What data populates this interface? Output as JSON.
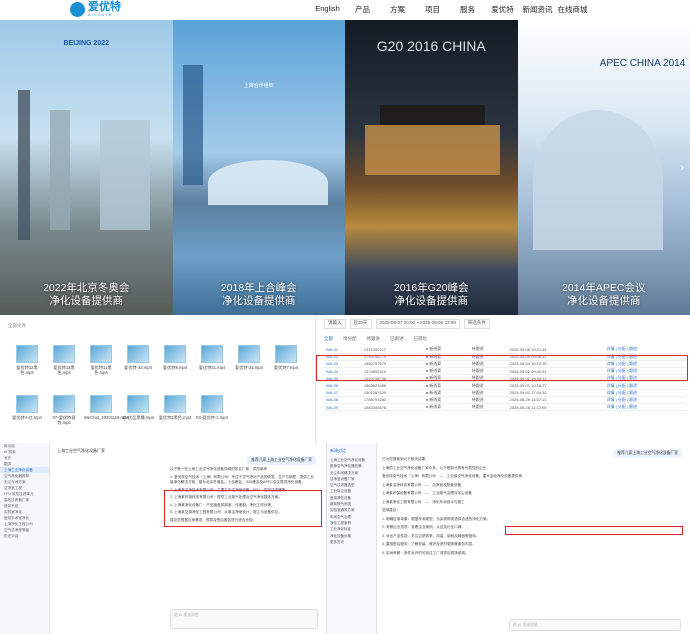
{
  "brand": {
    "name": "爱优特",
    "tagline": "AIYOUTE"
  },
  "nav": [
    "English",
    "产品",
    "方案",
    "项目",
    "服务",
    "爱优特",
    "新闻资讯",
    "在线商城"
  ],
  "banner": {
    "panels": [
      {
        "tag": "BEIJING 2022",
        "caption1": "2022年北京冬奥会",
        "caption2": "净化设备提供商"
      },
      {
        "tag": "上海合作组织",
        "caption1": "2018年上合峰会",
        "caption2": "净化设备提供商"
      },
      {
        "tag": "G20 2016 CHINA",
        "caption1": "2016年G20峰会",
        "caption2": "净化设备提供商"
      },
      {
        "tag": "APEC CHINA 2014",
        "caption1": "2014年APEC会议",
        "caption2": "净化设备提供商"
      }
    ],
    "arrow_right": "›"
  },
  "file_manager": {
    "header": "全部文件",
    "files": [
      "爱优特12黑色.mp4",
      "爱优特13黑色.mp4",
      "爱优特11黑色.mp4",
      "爱优特-32.mp4",
      "爱优特8.mp4",
      "爱优特31.mp4",
      "爱优特-31.mp4",
      "爱优特7.mp4",
      "爱优特4-红.mp4",
      "07-爱优特视频.mp4",
      "WeChat_20201116.mp4",
      "13-优品黑播.mp4",
      "爱优特3黑色.mp4",
      "03-爱优特-1.mp4"
    ]
  },
  "crm": {
    "toolbar": [
      "请输入",
      "近30天",
      "2025-08-07 00:00 ~ 2025-09-05 23:59",
      "筛选条件"
    ],
    "tabs": [
      "全部",
      "待分配",
      "待跟进",
      "已跟进",
      "已转化"
    ],
    "rows": [
      [
        "WA-01",
        "1371392217",
        "● 新线索",
        "待跟进",
        "2025-09-05 10:21:44"
      ],
      [
        "WA-02",
        "1793745779",
        "● 新线索",
        "待跟进",
        "2025-09-05 09:06:11"
      ],
      [
        "WA-03",
        "1860757679",
        "● 新线索",
        "待跟进",
        "2025-09-04 16:12:30"
      ],
      [
        "WA-04",
        "1374552310",
        "● 新线索",
        "待跟进",
        "2025-09-02 09:40:51"
      ],
      [
        "WA-05",
        "1393758736",
        "● 新线索",
        "待跟进",
        "2025-09-02 15:30:11"
      ],
      [
        "WA-06",
        "1865623456",
        "● 新线索",
        "待跟进",
        "2025-09-01 10:18:27"
      ],
      [
        "WA-07",
        "1501357520",
        "● 新线索",
        "待跟进",
        "2025-09-01 17:04:52"
      ],
      [
        "WA-08",
        "1789703282",
        "● 新线索",
        "待跟进",
        "2025-08-29 14:07:21"
      ],
      [
        "WA-09",
        "1582345678",
        "● 新线索",
        "待跟进",
        "2025-08-28 11:22:09"
      ]
    ],
    "actions": "详情 | 分配 | 跟进"
  },
  "chat1": {
    "header": "上海工业空气净化设备厂家",
    "sidebar": [
      "新对话",
      "AI 搜索",
      "写作",
      "翻译",
      "上海工业净化设备",
      "空气净化器推荐",
      "无尘车间方案",
      "洁净室工程",
      "FFU 风机过滤单元",
      "高效过滤器厂家",
      "新风系统",
      "实验室净化",
      "医院手术室净化",
      "上海净化工程公司",
      "空气洁净度等级",
      "历史对话"
    ],
    "question": "推荐几家上海工业空气净化设备厂家",
    "answer": [
      "以下是一些上海工业空气净化设备领域的知名厂家，供您参考：",
      "1. 爱优特空气技术（上海）有限公司：专注于空气净化产品的研发、生产与销售，提供工业级净化解决方案，曾为北京冬奥会、上合峰会、G20峰会及APEC会议提供净化设备。",
      "2. 上海某洁净技术有限公司：主要生产洁净室设备、FFU、高效过滤器等。",
      "3. 上海某环境科技有限公司：提供工业废气处理及空气净化整体方案。",
      "4. 上海某净化设备厂：产品涵盖风淋室、传递窗、净化工作台等。",
      "5. 上海某空调净化工程有限公司：从事洁净室设计、施工与设备供应。",
      "建议您根据自身需求、预算及售后服务进行综合比较。"
    ],
    "input_placeholder": "给 AI 发送消息"
  },
  "chat2": {
    "sidebar_title": "新建对话",
    "sidebar": [
      "上海工业空气净化设备",
      "推荐空气净化器品牌",
      "无尘车间解决方案",
      "洁净室设备厂家",
      "空气过滤器选型",
      "工业除尘设备",
      "医用净化设备",
      "新风换气系统",
      "实验室通风方案",
      "车间空气治理",
      "净化工程案例",
      "工业净化标准",
      "净化设备价格",
      "更多历史"
    ],
    "question": "推荐几家上海工业空气净化设备厂家",
    "answer": [
      "已为您搜索到以下相关结果：",
      "上海的工业空气净化设备厂家众多，以下是部分具有代表性的企业：",
      "爱优特空气技术（上海）有限公司　—　工业级空气净化设备，重大活动净化设备提供商",
      "上海某洁净科技有限公司　—　洁净室及配套设备",
      "上海某环保设备有限公司　—　工业废气治理与除尘设备",
      "上海某净化工程有限公司　—　净化车间设计与施工",
      "选择建议：",
      "1. 明确应用场景：根据车间类型、污染物种类选择合适的净化方案。",
      "2. 考察企业资质：查看企业案例、认证及行业口碑。",
      "3. 对比产品性能：关注过滤效率、风量、能耗及噪音等指标。",
      "4. 重视售后服务：了解安装、维护及滤材更换等服务内容。",
      "5. 实地考察：条件允许时可前往工厂或项目现场参观。"
    ],
    "input_placeholder": "给 AI 发送消息"
  }
}
